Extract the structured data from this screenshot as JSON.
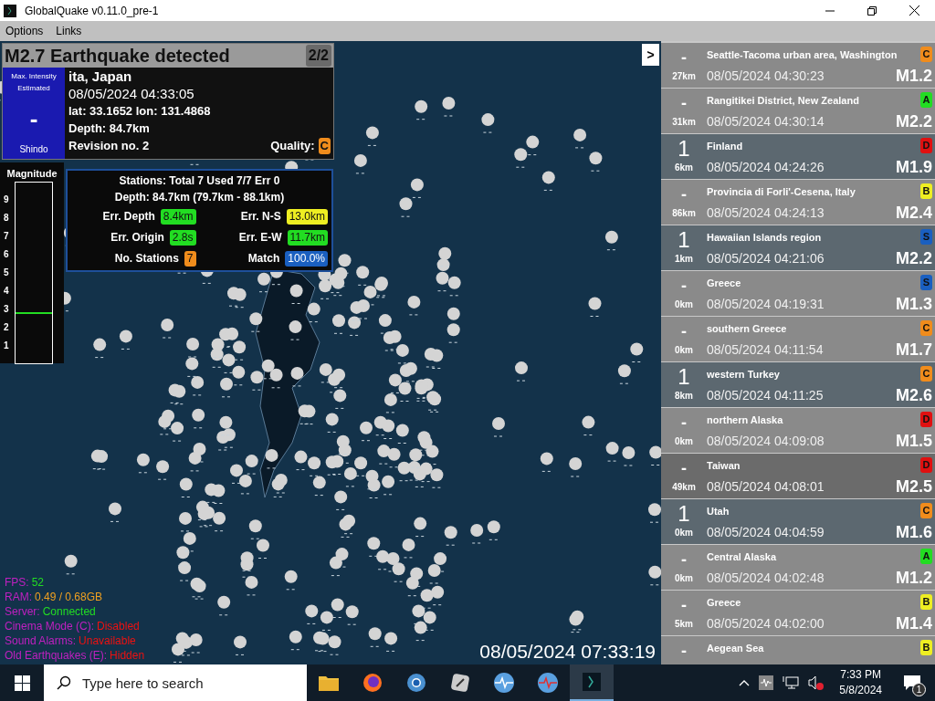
{
  "window": {
    "title": "GlobalQuake v0.11.0_pre-1"
  },
  "menu": [
    "Options",
    "Links"
  ],
  "alert": {
    "title": "M2.7 Earthquake detected",
    "counter": "2/2",
    "intensity_label": "Max. Intensity Estimated",
    "intensity": "-",
    "intensity_scale": "Shindo",
    "region": "ita, Japan",
    "time": "08/05/2024 04:33:05",
    "coords": "lat: 33.1652 lon: 131.4868",
    "depth": "Depth: 84.7km",
    "revision": "Revision no. 2",
    "quality_label": "Quality:",
    "quality": {
      "text": "C",
      "color": "#f08c1c"
    }
  },
  "magnitude_gauge": {
    "title": "Magnitude",
    "ticks": [
      "9",
      "8",
      "7",
      "6",
      "5",
      "4",
      "3",
      "2",
      "1"
    ],
    "level": 0.27
  },
  "stations": {
    "summary": "Stations: Total 7 Used 7/7 Err 0",
    "depth": "Depth: 84.7km (79.7km - 88.1km)",
    "metrics": [
      {
        "label": "Err. Depth",
        "value": "8.4km",
        "color": "#22dd22"
      },
      {
        "label": "Err. N-S",
        "value": "13.0km",
        "color": "#eeee22"
      },
      {
        "label": "Err. Origin",
        "value": "2.8s",
        "color": "#22dd22"
      },
      {
        "label": "Err. E-W",
        "value": "11.7km",
        "color": "#22dd22"
      },
      {
        "label": "No. Stations",
        "value": "7",
        "color": "#f08c1c"
      },
      {
        "label": "Match",
        "value": "100.0%",
        "color": "#1a5fc0"
      }
    ]
  },
  "status": [
    {
      "label": "FPS:",
      "value": "52",
      "color": "#22dd22"
    },
    {
      "label": "RAM:",
      "value": "0.49 / 0.68GB",
      "color": "#f0a020"
    },
    {
      "label": "Server:",
      "value": "Connected",
      "color": "#22dd22"
    },
    {
      "label": "Cinema Mode (C):",
      "value": "Disabled",
      "color": "#ee1111"
    },
    {
      "label": "Sound Alarms:",
      "value": "Unavailable",
      "color": "#ee1111"
    },
    {
      "label": "Old Earthquakes (E):",
      "value": "Hidden",
      "color": "#ee1111"
    }
  ],
  "clock": "08/05/2024 07:33:19",
  "collapse_button": ">",
  "events": [
    {
      "intensity": "-",
      "distance": "27km",
      "region": "Seattle-Tacoma urban area, Washington",
      "time": "08/05/2024 04:30:23",
      "magnitude": "M1.2",
      "quality": "C",
      "color": "#f08c1c",
      "shaded": false,
      "hovered": false
    },
    {
      "intensity": "-",
      "distance": "31km",
      "region": "Rangitikei District, New Zealand",
      "time": "08/05/2024 04:30:14",
      "magnitude": "M2.2",
      "quality": "A",
      "color": "#22dd22",
      "shaded": false,
      "hovered": false
    },
    {
      "intensity": "1",
      "distance": "6km",
      "region": "Finland",
      "time": "08/05/2024 04:24:26",
      "magnitude": "M1.9",
      "quality": "D",
      "color": "#e01010",
      "shaded": true,
      "hovered": false
    },
    {
      "intensity": "-",
      "distance": "86km",
      "region": "Provincia di Forli'-Cesena, Italy",
      "time": "08/05/2024 04:24:13",
      "magnitude": "M2.4",
      "quality": "B",
      "color": "#eeee22",
      "shaded": false,
      "hovered": false
    },
    {
      "intensity": "1",
      "distance": "1km",
      "region": "Hawaiian Islands region",
      "time": "08/05/2024 04:21:06",
      "magnitude": "M2.2",
      "quality": "S",
      "color": "#1a5fc0",
      "shaded": true,
      "hovered": false
    },
    {
      "intensity": "-",
      "distance": "0km",
      "region": "Greece",
      "time": "08/05/2024 04:19:31",
      "magnitude": "M1.3",
      "quality": "S",
      "color": "#1a5fc0",
      "shaded": false,
      "hovered": false
    },
    {
      "intensity": "-",
      "distance": "0km",
      "region": "southern Greece",
      "time": "08/05/2024 04:11:54",
      "magnitude": "M1.7",
      "quality": "C",
      "color": "#f08c1c",
      "shaded": false,
      "hovered": false
    },
    {
      "intensity": "1",
      "distance": "8km",
      "region": "western Turkey",
      "time": "08/05/2024 04:11:25",
      "magnitude": "M2.6",
      "quality": "C",
      "color": "#f08c1c",
      "shaded": true,
      "hovered": false
    },
    {
      "intensity": "-",
      "distance": "0km",
      "region": "northern Alaska",
      "time": "08/05/2024 04:09:08",
      "magnitude": "M1.5",
      "quality": "D",
      "color": "#e01010",
      "shaded": false,
      "hovered": false
    },
    {
      "intensity": "-",
      "distance": "49km",
      "region": "Taiwan",
      "time": "08/05/2024 04:08:01",
      "magnitude": "M2.5",
      "quality": "D",
      "color": "#e01010",
      "shaded": false,
      "hovered": true
    },
    {
      "intensity": "1",
      "distance": "0km",
      "region": "Utah",
      "time": "08/05/2024 04:04:59",
      "magnitude": "M1.6",
      "quality": "C",
      "color": "#f08c1c",
      "shaded": true,
      "hovered": false
    },
    {
      "intensity": "-",
      "distance": "0km",
      "region": "Central Alaska",
      "time": "08/05/2024 04:02:48",
      "magnitude": "M1.2",
      "quality": "A",
      "color": "#22dd22",
      "shaded": false,
      "hovered": false
    },
    {
      "intensity": "-",
      "distance": "5km",
      "region": "Greece",
      "time": "08/05/2024 04:02:00",
      "magnitude": "M1.4",
      "quality": "B",
      "color": "#eeee22",
      "shaded": false,
      "hovered": false
    },
    {
      "intensity": "-",
      "region": "Aegean Sea",
      "quality": "B",
      "color": "#eeee22",
      "shaded": false,
      "hovered": false
    }
  ],
  "taskbar": {
    "search_placeholder": "Type here to search",
    "time": "7:33 PM",
    "date": "5/8/2024",
    "notifications": "1"
  }
}
